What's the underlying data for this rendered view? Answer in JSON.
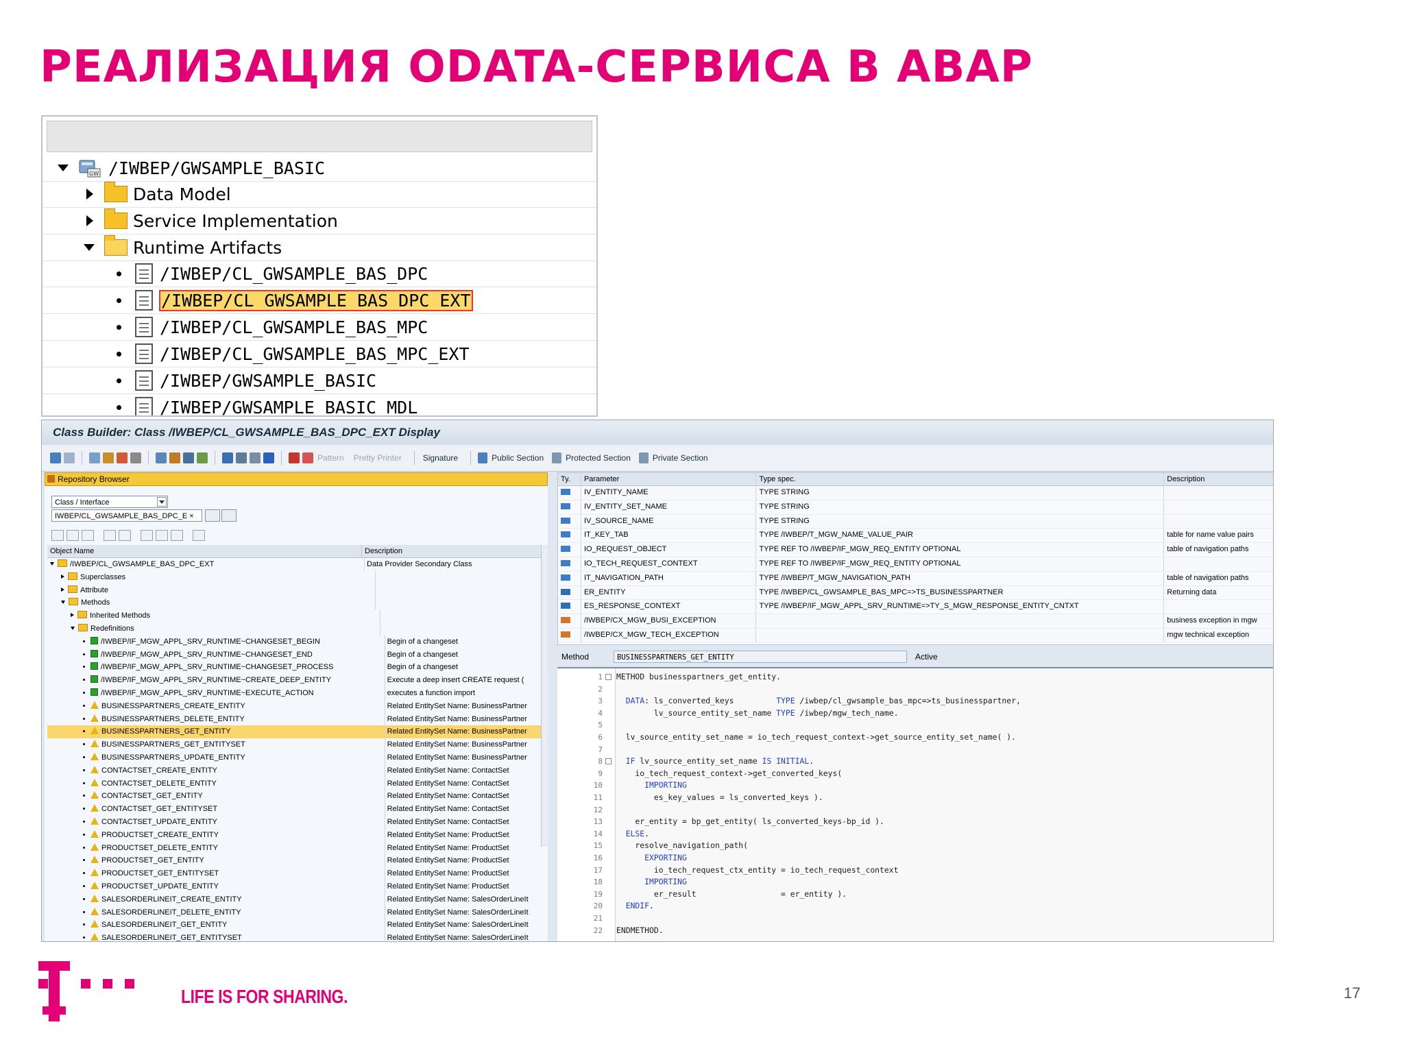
{
  "slide": {
    "title": "РЕАЛИЗАЦИЯ ODATA-СЕРВИСА В ABAP",
    "tagline": "LIFE IS FOR SHARING.",
    "page_number": "17",
    "brand_color": "#e20074"
  },
  "service_tree": {
    "root": "/IWBEP/GWSAMPLE_BASIC",
    "folders": [
      "Data Model",
      "Service Implementation",
      "Runtime Artifacts"
    ],
    "artifacts": [
      "/IWBEP/CL_GWSAMPLE_BAS_DPC",
      "/IWBEP/CL_GWSAMPLE_BAS_DPC_EXT",
      "/IWBEP/CL_GWSAMPLE_BAS_MPC",
      "/IWBEP/CL_GWSAMPLE_BAS_MPC_EXT",
      "/IWBEP/GWSAMPLE_BASIC",
      "/IWBEP/GWSAMPLE_BASIC_MDL"
    ],
    "selected_artifact": "/IWBEP/CL_GWSAMPLE_BAS_DPC_EXT"
  },
  "class_builder": {
    "title": "Class Builder: Class /IWBEP/CL_GWSAMPLE_BAS_DPC_EXT Display",
    "toolbar": {
      "pattern": "Pattern",
      "pretty_printer": "Pretty Printer",
      "signature": "Signature",
      "public_section": "Public Section",
      "protected_section": "Protected Section",
      "private_section": "Private Section"
    },
    "repository": {
      "header": "Repository Browser",
      "type_select": "Class / Interface",
      "object_input": "IWBEP/CL_GWSAMPLE_BAS_DPC_E ×",
      "columns": [
        "Object Name",
        "Description"
      ],
      "rows": [
        {
          "name": "/IWBEP/CL_GWSAMPLE_BAS_DPC_EXT",
          "desc": "Data Provider Secondary Class"
        },
        {
          "name": "Superclasses",
          "desc": ""
        },
        {
          "name": "Attribute",
          "desc": ""
        },
        {
          "name": "Methods",
          "desc": ""
        },
        {
          "name": "Inherited Methods",
          "desc": ""
        },
        {
          "name": "Redefinitions",
          "desc": ""
        },
        {
          "name": "/IWBEP/IF_MGW_APPL_SRV_RUNTIME~CHANGESET_BEGIN",
          "desc": "Begin of a changeset"
        },
        {
          "name": "/IWBEP/IF_MGW_APPL_SRV_RUNTIME~CHANGESET_END",
          "desc": "Begin of a changeset"
        },
        {
          "name": "/IWBEP/IF_MGW_APPL_SRV_RUNTIME~CHANGESET_PROCESS",
          "desc": "Begin of a changeset"
        },
        {
          "name": "/IWBEP/IF_MGW_APPL_SRV_RUNTIME~CREATE_DEEP_ENTITY",
          "desc": "Execute a deep insert CREATE request ("
        },
        {
          "name": "/IWBEP/IF_MGW_APPL_SRV_RUNTIME~EXECUTE_ACTION",
          "desc": "executes a function import"
        },
        {
          "name": "BUSINESSPARTNERS_CREATE_ENTITY",
          "desc": "Related EntitySet Name: BusinessPartner"
        },
        {
          "name": "BUSINESSPARTNERS_DELETE_ENTITY",
          "desc": "Related EntitySet Name: BusinessPartner"
        },
        {
          "name": "BUSINESSPARTNERS_GET_ENTITY",
          "desc": "Related EntitySet Name: BusinessPartner"
        },
        {
          "name": "BUSINESSPARTNERS_GET_ENTITYSET",
          "desc": "Related EntitySet Name: BusinessPartner"
        },
        {
          "name": "BUSINESSPARTNERS_UPDATE_ENTITY",
          "desc": "Related EntitySet Name: BusinessPartner"
        },
        {
          "name": "CONTACTSET_CREATE_ENTITY",
          "desc": "Related EntitySet Name: ContactSet"
        },
        {
          "name": "CONTACTSET_DELETE_ENTITY",
          "desc": "Related EntitySet Name: ContactSet"
        },
        {
          "name": "CONTACTSET_GET_ENTITY",
          "desc": "Related EntitySet Name: ContactSet"
        },
        {
          "name": "CONTACTSET_GET_ENTITYSET",
          "desc": "Related EntitySet Name: ContactSet"
        },
        {
          "name": "CONTACTSET_UPDATE_ENTITY",
          "desc": "Related EntitySet Name: ContactSet"
        },
        {
          "name": "PRODUCTSET_CREATE_ENTITY",
          "desc": "Related EntitySet Name: ProductSet"
        },
        {
          "name": "PRODUCTSET_DELETE_ENTITY",
          "desc": "Related EntitySet Name: ProductSet"
        },
        {
          "name": "PRODUCTSET_GET_ENTITY",
          "desc": "Related EntitySet Name: ProductSet"
        },
        {
          "name": "PRODUCTSET_GET_ENTITYSET",
          "desc": "Related EntitySet Name: ProductSet"
        },
        {
          "name": "PRODUCTSET_UPDATE_ENTITY",
          "desc": "Related EntitySet Name: ProductSet"
        },
        {
          "name": "SALESORDERLINEIT_CREATE_ENTITY",
          "desc": "Related EntitySet Name: SalesOrderLineIt"
        },
        {
          "name": "SALESORDERLINEIT_DELETE_ENTITY",
          "desc": "Related EntitySet Name: SalesOrderLineIt"
        },
        {
          "name": "SALESORDERLINEIT_GET_ENTITY",
          "desc": "Related EntitySet Name: SalesOrderLineIt"
        },
        {
          "name": "SALESORDERLINEIT_GET_ENTITYSET",
          "desc": "Related EntitySet Name: SalesOrderLineIt"
        }
      ]
    },
    "parameters": {
      "columns": [
        "Ty.",
        "Parameter",
        "Type spec.",
        "Description"
      ],
      "rows": [
        {
          "name": "IV_ENTITY_NAME",
          "type": "TYPE STRING",
          "desc": ""
        },
        {
          "name": "IV_ENTITY_SET_NAME",
          "type": "TYPE STRING",
          "desc": ""
        },
        {
          "name": "IV_SOURCE_NAME",
          "type": "TYPE STRING",
          "desc": ""
        },
        {
          "name": "IT_KEY_TAB",
          "type": "TYPE /IWBEP/T_MGW_NAME_VALUE_PAIR",
          "desc": "table for name value pairs"
        },
        {
          "name": "IO_REQUEST_OBJECT",
          "type": "TYPE REF TO /IWBEP/IF_MGW_REQ_ENTITY OPTIONAL",
          "desc": "table of navigation paths"
        },
        {
          "name": "IO_TECH_REQUEST_CONTEXT",
          "type": "TYPE REF TO /IWBEP/IF_MGW_REQ_ENTITY OPTIONAL",
          "desc": ""
        },
        {
          "name": "IT_NAVIGATION_PATH",
          "type": "TYPE /IWBEP/T_MGW_NAVIGATION_PATH",
          "desc": "table of navigation paths"
        },
        {
          "name": "ER_ENTITY",
          "type": "TYPE /IWBEP/CL_GWSAMPLE_BAS_MPC=>TS_BUSINESSPARTNER",
          "desc": "Returning data"
        },
        {
          "name": "ES_RESPONSE_CONTEXT",
          "type": "TYPE /IWBEP/IF_MGW_APPL_SRV_RUNTIME=>TY_S_MGW_RESPONSE_ENTITY_CNTXT",
          "desc": ""
        },
        {
          "name": "/IWBEP/CX_MGW_BUSI_EXCEPTION",
          "type": "",
          "desc": "business exception in mgw"
        },
        {
          "name": "/IWBEP/CX_MGW_TECH_EXCEPTION",
          "type": "",
          "desc": "mgw technical exception"
        }
      ]
    },
    "method": {
      "label": "Method",
      "name": "BUSINESSPARTNERS_GET_ENTITY",
      "status": "Active"
    },
    "code": [
      "METHOD businesspartners_get_entity.",
      "",
      "  DATA: ls_converted_keys         TYPE /iwbep/cl_gwsample_bas_mpc=>ts_businesspartner,",
      "        lv_source_entity_set_name TYPE /iwbep/mgw_tech_name.",
      "",
      "  lv_source_entity_set_name = io_tech_request_context->get_source_entity_set_name( ).",
      "",
      "  IF lv_source_entity_set_name IS INITIAL.",
      "    io_tech_request_context->get_converted_keys(",
      "      IMPORTING",
      "        es_key_values = ls_converted_keys ).",
      "",
      "    er_entity = bp_get_entity( ls_converted_keys-bp_id ).",
      "  ELSE.",
      "    resolve_navigation_path(",
      "      EXPORTING",
      "        io_tech_request_ctx_entity = io_tech_request_context",
      "      IMPORTING",
      "        er_result                  = er_entity ).",
      "  ENDIF.",
      "",
      "ENDMETHOD."
    ]
  }
}
